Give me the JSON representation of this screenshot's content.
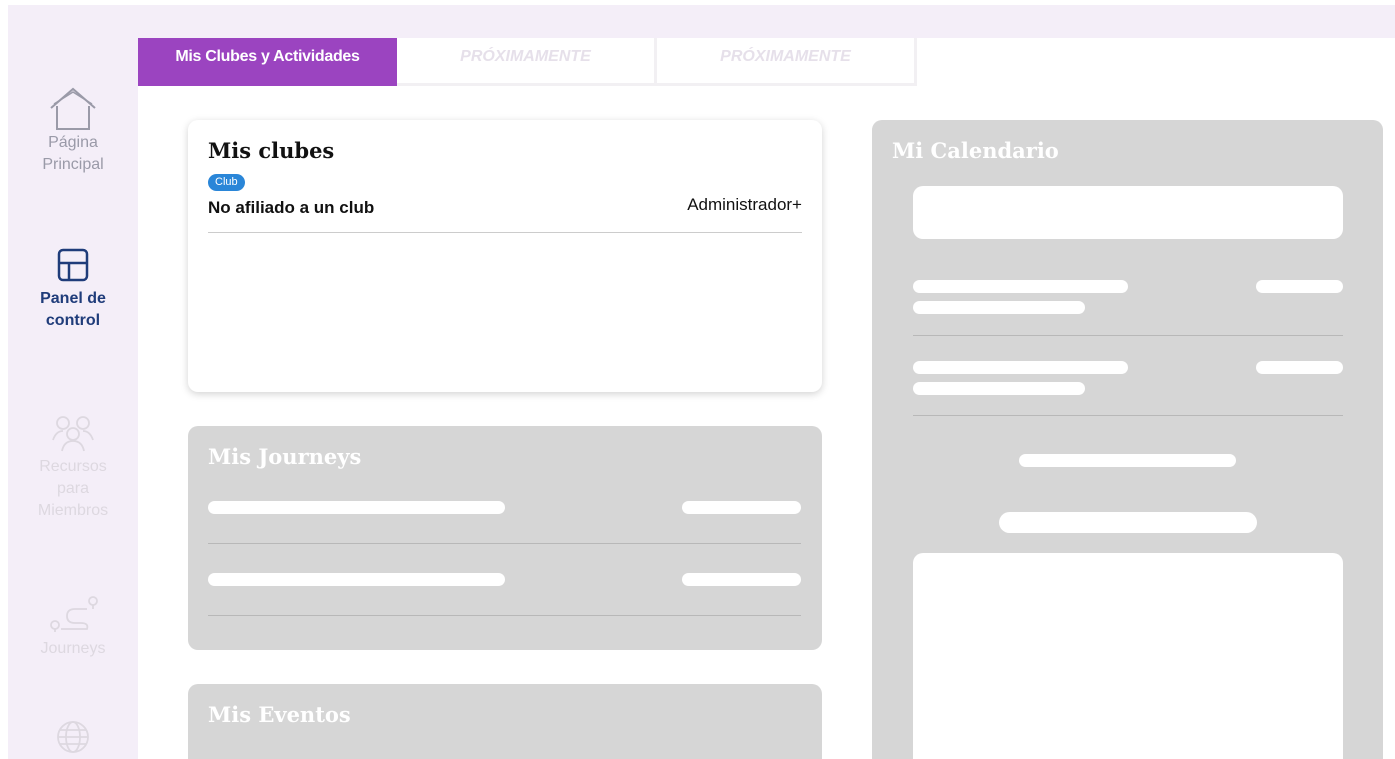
{
  "tabs": [
    {
      "label": "Mis Clubes y Actividades",
      "active": true
    },
    {
      "label": "PRÓXIMAMENTE",
      "active": false
    },
    {
      "label": "PRÓXIMAMENTE",
      "active": false
    }
  ],
  "sidebar": {
    "items": [
      {
        "label_line1": "Página",
        "label_line2": "Principal",
        "icon": "home-icon"
      },
      {
        "label_line1": "Panel de",
        "label_line2": "control",
        "icon": "dashboard-icon",
        "active": true
      },
      {
        "label_line1": "Recursos",
        "label_line2": "para",
        "label_line3": "Miembros",
        "icon": "people-icon"
      },
      {
        "label_line1": "Journeys",
        "icon": "route-icon"
      },
      {
        "icon": "globe-icon"
      }
    ]
  },
  "clubs_card": {
    "title": "Mis clubes",
    "badge": "Club",
    "club_name": "No afiliado a un club",
    "role": "Administrador+"
  },
  "journeys_card": {
    "title": "Mis Journeys"
  },
  "events_card": {
    "title": "Mis Eventos"
  },
  "calendar_card": {
    "title": "Mi Calendario"
  },
  "colors": {
    "accent_purple": "#9b44c0",
    "sidebar_bg": "#f4eef8",
    "active_nav": "#1f3c7a",
    "badge_blue": "#2a86d8",
    "placeholder_gray": "#d6d6d6"
  }
}
